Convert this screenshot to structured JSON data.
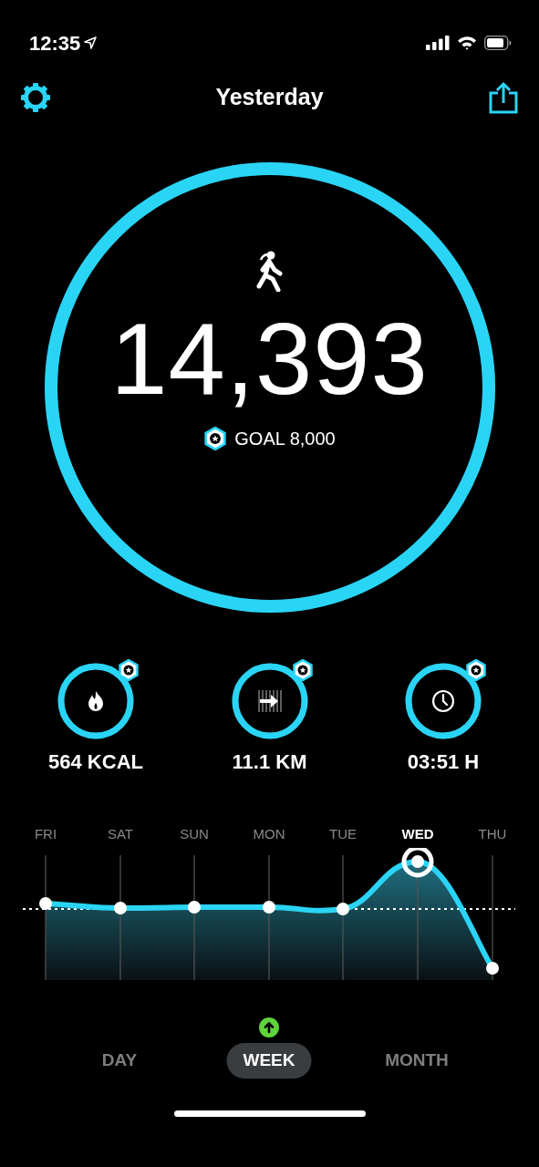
{
  "status_bar": {
    "time": "12:35",
    "location_active": true
  },
  "header": {
    "title": "Yesterday"
  },
  "steps": {
    "value": "14,393",
    "goal": "GOAL 8,000",
    "level": 1,
    "goal_reached": true
  },
  "metrics": [
    {
      "kind": "calories",
      "value": "564 KCAL",
      "level": 1,
      "goal_reached": true
    },
    {
      "kind": "distance",
      "value": "11.1 KM",
      "level": 1,
      "goal_reached": true
    },
    {
      "kind": "duration",
      "value": "03:51 H",
      "level": 1,
      "goal_reached": true
    }
  ],
  "week_chart": {
    "days": [
      {
        "label": "FRI",
        "selected": false
      },
      {
        "label": "SAT",
        "selected": false
      },
      {
        "label": "SUN",
        "selected": false
      },
      {
        "label": "MON",
        "selected": false
      },
      {
        "label": "TUE",
        "selected": false
      },
      {
        "label": "WED",
        "selected": true
      },
      {
        "label": "THU",
        "selected": false
      }
    ]
  },
  "period_tabs": {
    "trend_up": true,
    "tabs": [
      {
        "label": "DAY",
        "selected": false
      },
      {
        "label": "WEEK",
        "selected": true
      },
      {
        "label": "MONTH",
        "selected": false
      }
    ]
  }
}
